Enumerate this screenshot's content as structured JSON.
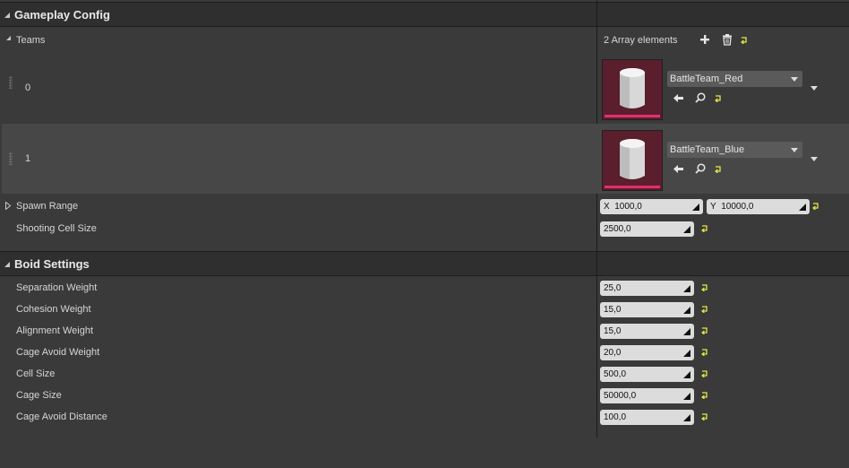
{
  "gameplay": {
    "header": "Gameplay Config",
    "teams": {
      "label": "Teams",
      "count_text": "2 Array elements",
      "items": [
        {
          "index": "0",
          "asset": "BattleTeam_Red"
        },
        {
          "index": "1",
          "asset": "BattleTeam_Blue"
        }
      ]
    },
    "spawn_range": {
      "label": "Spawn Range",
      "x_prefix": "X",
      "x": "1000,0",
      "y_prefix": "Y",
      "y": "10000,0"
    },
    "shooting_cell_size": {
      "label": "Shooting Cell Size",
      "value": "2500,0"
    }
  },
  "boid": {
    "header": "Boid Settings",
    "fields": [
      {
        "label": "Separation Weight",
        "value": "25,0"
      },
      {
        "label": "Cohesion Weight",
        "value": "15,0"
      },
      {
        "label": "Alignment Weight",
        "value": "15,0"
      },
      {
        "label": "Cage Avoid Weight",
        "value": "20,0"
      },
      {
        "label": "Cell Size",
        "value": "500,0"
      },
      {
        "label": "Cage Size",
        "value": "50000,0"
      },
      {
        "label": "Cage Avoid Distance",
        "value": "100,0"
      }
    ]
  },
  "colors": {
    "reset_arrow": "#e8e84a",
    "thumbnail_bg": "#5a1e2c",
    "thumbnail_bar": "#e0306e"
  }
}
